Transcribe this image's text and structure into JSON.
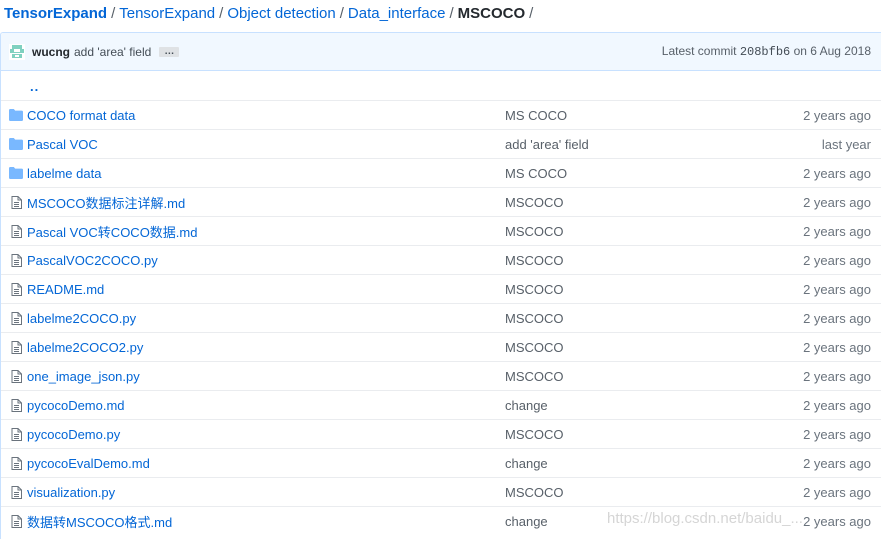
{
  "breadcrumb": {
    "root": "TensorExpand",
    "items": [
      "TensorExpand",
      "Object detection",
      "Data_interface"
    ],
    "separator": "/",
    "current": "MSCOCO"
  },
  "commit": {
    "author": "wucng",
    "message": "add 'area' field",
    "ellipsis": "…",
    "latest_label": "Latest commit",
    "sha": "208bfb6",
    "date_text": "on 6 Aug 2018"
  },
  "parent_dir": "..",
  "files": [
    {
      "type": "dir",
      "name": "COCO format data",
      "message": "MS COCO",
      "age": "2 years ago"
    },
    {
      "type": "dir",
      "name": "Pascal VOC",
      "message": "add 'area' field",
      "age": "last year"
    },
    {
      "type": "dir",
      "name": "labelme data",
      "message": "MS COCO",
      "age": "2 years ago"
    },
    {
      "type": "file",
      "name": "MSCOCO数据标注详解.md",
      "message": "MSCOCO",
      "age": "2 years ago"
    },
    {
      "type": "file",
      "name": "Pascal VOC转COCO数据.md",
      "message": "MSCOCO",
      "age": "2 years ago"
    },
    {
      "type": "file",
      "name": "PascalVOC2COCO.py",
      "message": "MSCOCO",
      "age": "2 years ago"
    },
    {
      "type": "file",
      "name": "README.md",
      "message": "MSCOCO",
      "age": "2 years ago"
    },
    {
      "type": "file",
      "name": "labelme2COCO.py",
      "message": "MSCOCO",
      "age": "2 years ago"
    },
    {
      "type": "file",
      "name": "labelme2COCO2.py",
      "message": "MSCOCO",
      "age": "2 years ago"
    },
    {
      "type": "file",
      "name": "one_image_json.py",
      "message": "MSCOCO",
      "age": "2 years ago"
    },
    {
      "type": "file",
      "name": "pycocoDemo.md",
      "message": "change",
      "age": "2 years ago"
    },
    {
      "type": "file",
      "name": "pycocoDemo.py",
      "message": "MSCOCO",
      "age": "2 years ago"
    },
    {
      "type": "file",
      "name": "pycocoEvalDemo.md",
      "message": "change",
      "age": "2 years ago"
    },
    {
      "type": "file",
      "name": "visualization.py",
      "message": "MSCOCO",
      "age": "2 years ago"
    },
    {
      "type": "file",
      "name": "数据转MSCOCO格式.md",
      "message": "change",
      "age": "2 years ago"
    }
  ],
  "watermark": "https://blog.csdn.net/baidu_...",
  "colors": {
    "link": "#0366d6",
    "folder_icon": "#79b8ff",
    "file_icon": "#6a737d",
    "commit_bar_bg": "#f1f8ff",
    "border": "#c8e1ff"
  }
}
